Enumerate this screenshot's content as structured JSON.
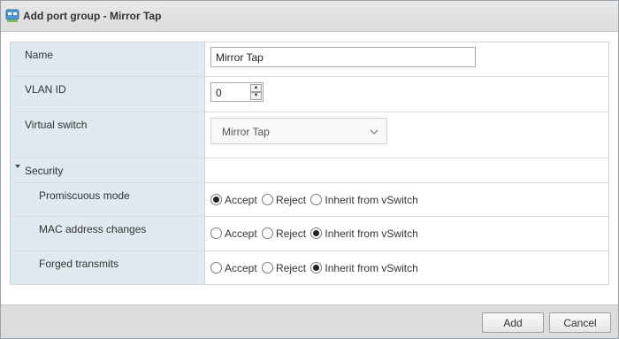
{
  "dialog": {
    "title": "Add port group - Mirror Tap",
    "icon": "port-group-icon"
  },
  "form": {
    "name_label": "Name",
    "name_value": "Mirror Tap",
    "vlan_label": "VLAN ID",
    "vlan_value": "0",
    "vswitch_label": "Virtual switch",
    "vswitch_value": "Mirror Tap",
    "security_label": "Security",
    "security_expanded": true,
    "options": [
      "Accept",
      "Reject",
      "Inherit from vSwitch"
    ],
    "promiscuous": {
      "label": "Promiscuous mode",
      "selected": "Accept"
    },
    "mac_changes": {
      "label": "MAC address changes",
      "selected": "Inherit from vSwitch"
    },
    "forged": {
      "label": "Forged transmits",
      "selected": "Inherit from vSwitch"
    }
  },
  "footer": {
    "add_label": "Add",
    "cancel_label": "Cancel"
  }
}
